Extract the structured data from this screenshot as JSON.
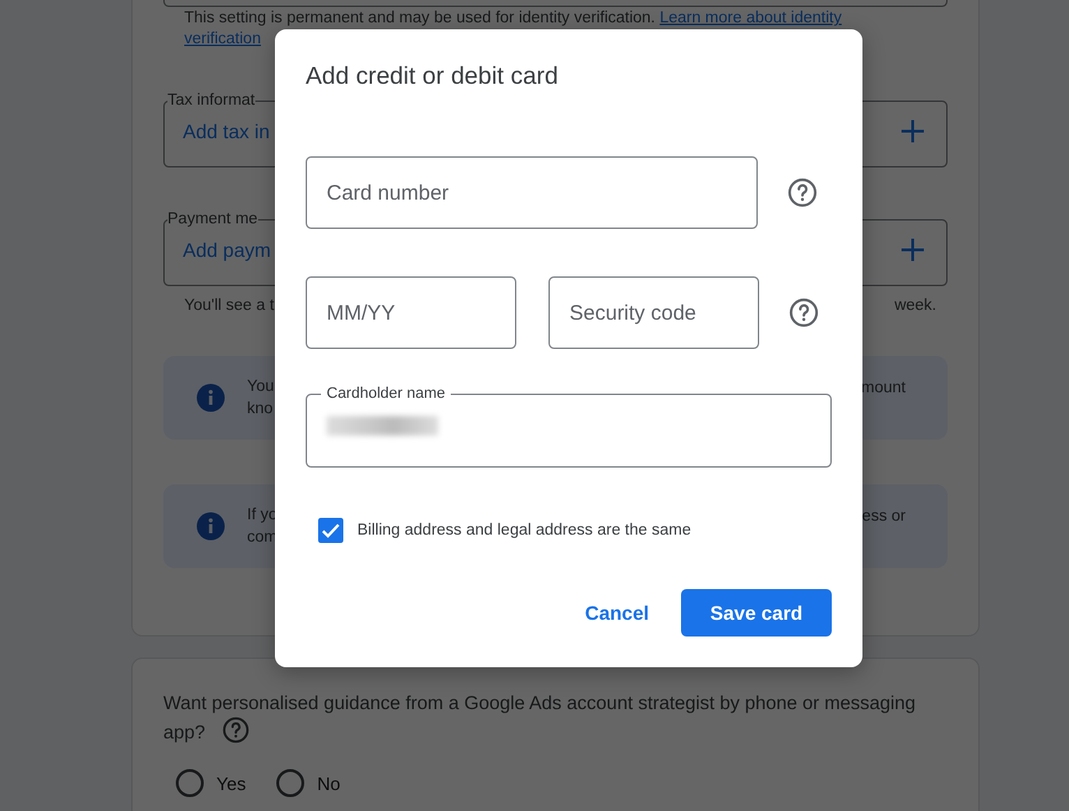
{
  "page": {
    "notice": {
      "text": "This setting is permanent and may be used for identity verification.",
      "link_lines": [
        "Learn more about identity",
        "verification"
      ]
    },
    "sections": [
      {
        "legend": "Tax informat",
        "action": "Add tax in"
      },
      {
        "legend": "Payment me",
        "action": "Add paym"
      }
    ],
    "payment_note": {
      "left": "You'll see a t",
      "right": "week."
    },
    "info_boxes": [
      {
        "left": [
          "You",
          "kno"
        ],
        "right": [
          "mount"
        ]
      },
      {
        "left": [
          "If yo",
          "com"
        ],
        "right": [
          "ess or"
        ]
      }
    ],
    "guidance": {
      "question": "Want personalised guidance from a Google Ads account strategist by phone or messaging app?",
      "options": [
        {
          "label": "Yes",
          "selected": false
        },
        {
          "label": "No",
          "selected": false
        }
      ]
    }
  },
  "dialog": {
    "title": "Add credit or debit card",
    "rows": [
      {
        "fields": [
          {
            "placeholder": "Card number"
          }
        ],
        "help": true
      },
      {
        "fields": [
          {
            "placeholder": "MM/YY"
          },
          {
            "placeholder": "Security code"
          }
        ],
        "help": true
      }
    ],
    "cardholder": {
      "label": "Cardholder name"
    },
    "checkbox": {
      "label": "Billing address and legal address are the same",
      "checked": true
    },
    "buttons": [
      {
        "label": "Cancel",
        "kind": "text"
      },
      {
        "label": "Save card",
        "kind": "filled"
      }
    ]
  }
}
